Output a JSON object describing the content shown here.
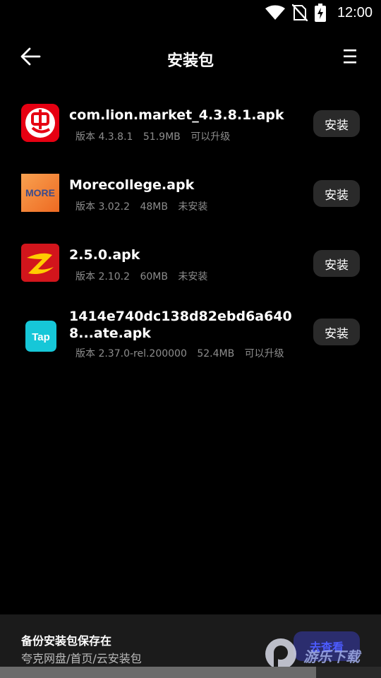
{
  "status_bar": {
    "time": "12:00",
    "icons": [
      "wifi-icon",
      "no-sim-icon",
      "battery-charging-icon"
    ]
  },
  "header": {
    "title": "安装包",
    "back_icon": "arrow-left-icon",
    "menu_icon": "menu-icon"
  },
  "packages": [
    {
      "name": "com.lion.market_4.3.8.1.apk",
      "version": "版本 4.3.8.1",
      "size": "51.9MB",
      "status": "可以升级",
      "button": "安装",
      "icon": "chong-icon",
      "icon_bg": "#e60012"
    },
    {
      "name": "Morecollege.apk",
      "version": "版本 3.02.2",
      "size": "48MB",
      "status": "未安装",
      "button": "安装",
      "icon": "more-icon",
      "icon_text": "MORE",
      "icon_bg": "#f07a2a"
    },
    {
      "name": "2.5.0.apk",
      "version": "版本 2.10.2",
      "size": "60MB",
      "status": "未安装",
      "button": "安装",
      "icon": "swoosh-icon",
      "icon_bg": "#d2151c"
    },
    {
      "name": "1414e740dc138d82ebd6a6408...ate.apk",
      "version": "版本 2.37.0-rel.200000",
      "size": "52.4MB",
      "status": "可以升级",
      "button": "安装",
      "icon": "tap-icon",
      "icon_text": "Tap",
      "icon_bg": "#16c7d8"
    }
  ],
  "bottom_bar": {
    "title": "备份安装包保存在",
    "path": "夸克网盘/首页/云安装包",
    "action_label": "去查看"
  },
  "watermark": {
    "text": "游乐下载"
  }
}
